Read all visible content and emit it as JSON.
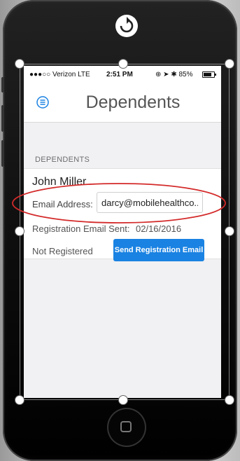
{
  "status_bar": {
    "carrier": "●●●○○ Verizon  LTE",
    "time": "2:51 PM",
    "right_info": "⊕ ➤ ✱ 85%"
  },
  "nav": {
    "title": "Dependents",
    "menu_icon": "hamburger-menu-icon"
  },
  "section": {
    "label": "DEPENDENTS"
  },
  "dependent": {
    "name": "John Miller",
    "email_label": "Email Address:",
    "email_value": "darcy@mobilehealthco...",
    "registration_sent_label": "Registration Email Sent:",
    "registration_sent_date": "02/16/2016",
    "status": "Not Registered",
    "send_button_label": "Send Registration Email"
  },
  "colors": {
    "accent": "#1a82e2",
    "annotation": "#d42a2a"
  }
}
